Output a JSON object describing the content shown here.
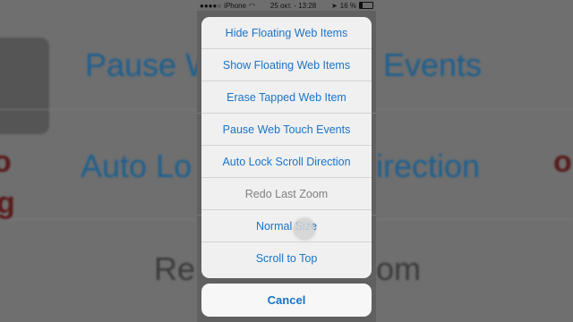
{
  "status_bar": {
    "signal": "●●●●○",
    "carrier": "iPhone",
    "time": "25 окт. - 13:28",
    "battery_pct": "16 %"
  },
  "action_sheet": {
    "items": [
      {
        "label": "Hide Floating Web Items",
        "enabled": true
      },
      {
        "label": "Show Floating Web Items",
        "enabled": true
      },
      {
        "label": "Erase Tapped Web Item",
        "enabled": true
      },
      {
        "label": "Pause Web Touch Events",
        "enabled": true
      },
      {
        "label": "Auto Lock Scroll Direction",
        "enabled": true
      },
      {
        "label": "Redo Last Zoom",
        "enabled": false
      },
      {
        "label": "Normal Size",
        "enabled": true
      },
      {
        "label": "Scroll to Top",
        "enabled": true
      }
    ],
    "cancel_label": "Cancel"
  },
  "background": {
    "left_lines": [
      "Pause W",
      "Auto Lo",
      "Re"
    ],
    "right_lines": [
      "Events",
      "irection",
      "om"
    ]
  },
  "colors": {
    "accent": "#1a74c8",
    "disabled": "#808080",
    "sheet_bg": "#f0f0f0"
  }
}
